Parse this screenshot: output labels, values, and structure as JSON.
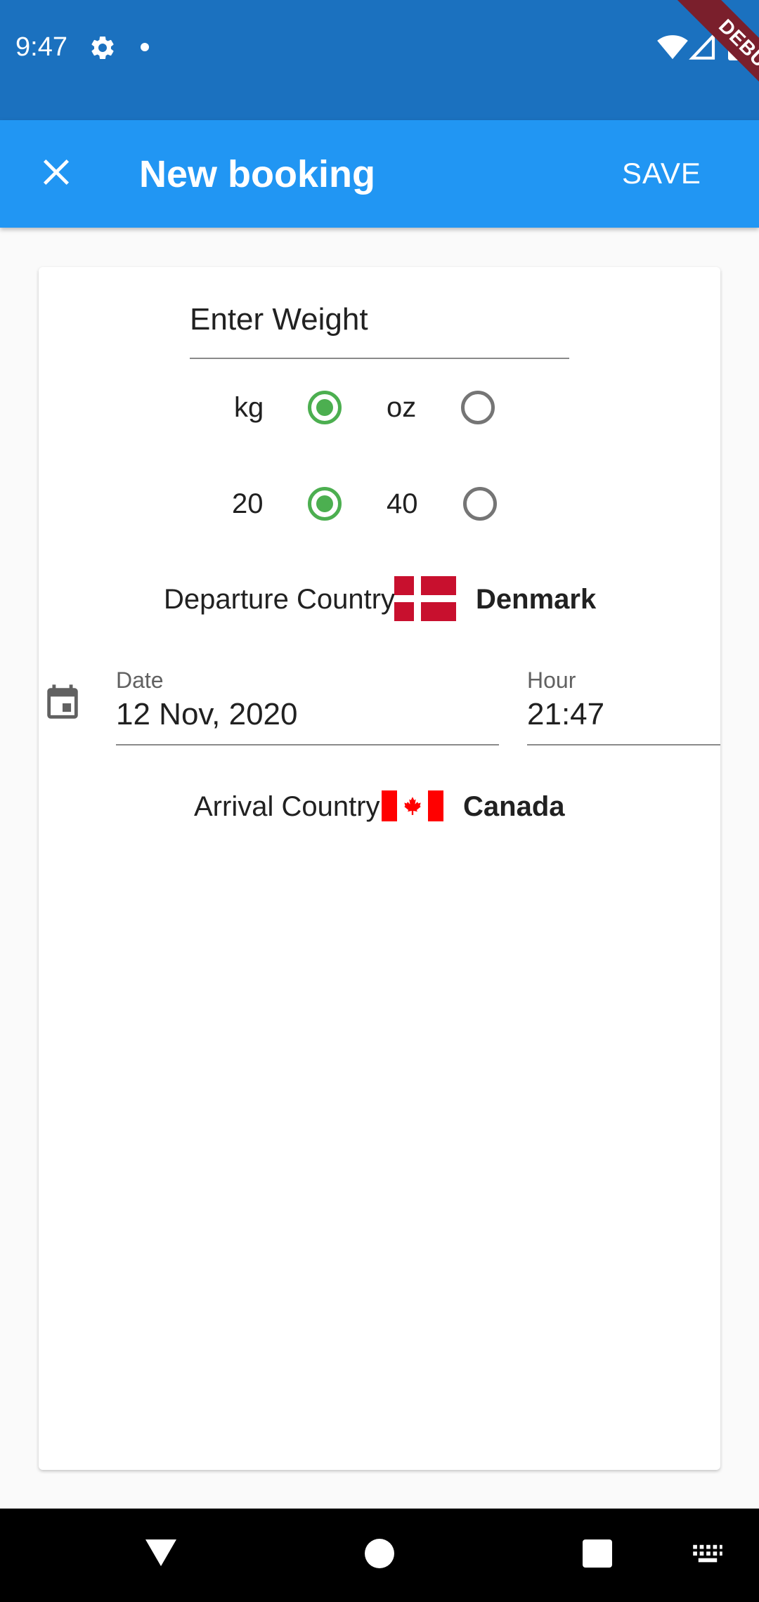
{
  "status_bar": {
    "time": "9:47",
    "debug_banner": "DEBUG",
    "icons": [
      "settings-icon",
      "notification-dot-icon",
      "wifi-icon",
      "signal-icon",
      "battery-icon"
    ]
  },
  "app_bar": {
    "title": "New booking",
    "close_icon": "close-icon",
    "save_label": "SAVE"
  },
  "form": {
    "weight": {
      "placeholder": "Enter Weight",
      "value": ""
    },
    "unit": {
      "options": [
        "kg",
        "oz"
      ],
      "selected": "kg"
    },
    "amount": {
      "options": [
        "20",
        "40"
      ],
      "selected": "20"
    },
    "departure": {
      "label": "Departure Country",
      "country": "Denmark",
      "flag": "denmark-flag"
    },
    "date": {
      "label": "Date",
      "value": "12 Nov, 2020",
      "icon": "calendar-icon"
    },
    "hour": {
      "label": "Hour",
      "value": "21:47"
    },
    "arrival": {
      "label": "Arrival Country",
      "country": "Canada",
      "flag": "canada-flag"
    }
  },
  "colors": {
    "status_bar": "#1b71bf",
    "app_bar": "#2196f3",
    "radio_selected": "#4caf50",
    "radio_unselected": "#757575"
  },
  "nav_bar": {
    "buttons": [
      "back-button",
      "home-button",
      "recents-button",
      "keyboard-icon"
    ]
  }
}
